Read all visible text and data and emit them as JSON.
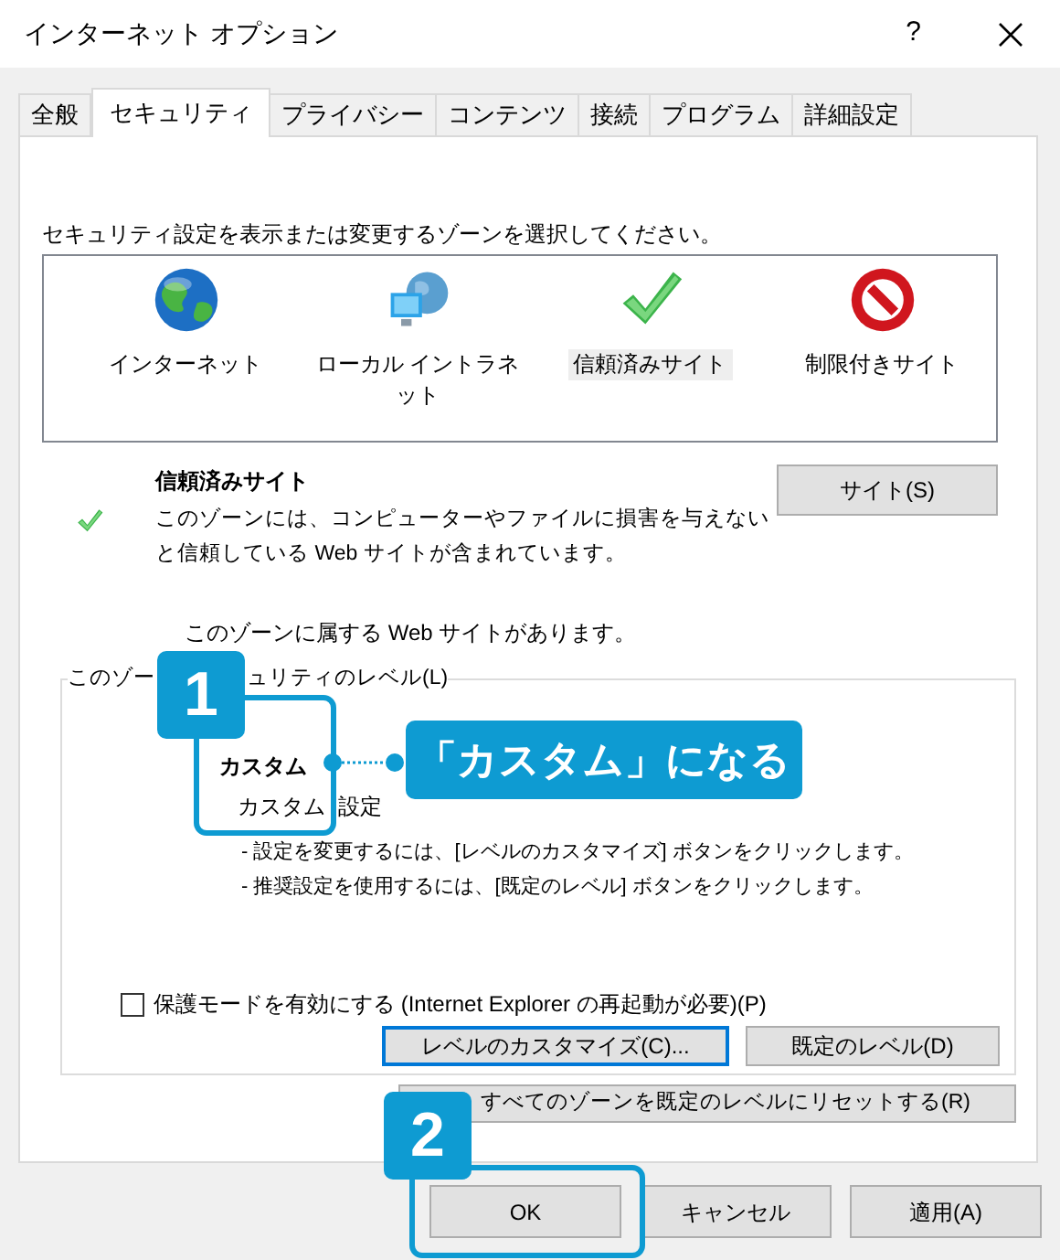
{
  "window": {
    "title": "インターネット オプション",
    "help": "?"
  },
  "tabs": [
    {
      "label": "全般",
      "selected": false
    },
    {
      "label": "セキュリティ",
      "selected": true
    },
    {
      "label": "プライバシー",
      "selected": false
    },
    {
      "label": "コンテンツ",
      "selected": false
    },
    {
      "label": "接続",
      "selected": false
    },
    {
      "label": "プログラム",
      "selected": false
    },
    {
      "label": "詳細設定",
      "selected": false
    }
  ],
  "instruction": "セキュリティ設定を表示または変更するゾーンを選択してください。",
  "zones": [
    {
      "label": "インターネット",
      "kind": "globe",
      "selected": false
    },
    {
      "label": "ローカル イントラネット",
      "kind": "network",
      "selected": false
    },
    {
      "label": "信頼済みサイト",
      "kind": "check",
      "selected": true
    },
    {
      "label": "制限付きサイト",
      "kind": "blocked",
      "selected": false
    }
  ],
  "zone_detail": {
    "title": "信頼済みサイト",
    "description": "このゾーンには、コンピューターやファイルに損害を与えないと信頼している Web サイトが含まれています。",
    "button": "サイト(S)",
    "note": "このゾーンに属する Web サイトがあります。"
  },
  "level_group": {
    "label_parts": [
      "このゾー",
      "ュリティのレベル(L)"
    ],
    "level_name": "カスタム",
    "level_desc": [
      "カスタム",
      "設定"
    ],
    "bullets": [
      "- 設定を変更するには、[レベルのカスタマイズ] ボタンをクリックします。",
      "- 推奨設定を使用するには、[既定のレベル] ボタンをクリックします。"
    ],
    "protected_mode": {
      "label": "保護モードを有効にする (Internet Explorer の再起動が必要)(P)",
      "checked": false
    },
    "buttons": [
      {
        "label": "レベルのカスタマイズ(C)...",
        "focused": true
      },
      {
        "label": "既定のレベル(D)",
        "focused": false
      }
    ]
  },
  "reset_button": "すべてのゾーンを既定のレベルにリセットする(R)",
  "dialog_buttons": [
    "OK",
    "キャンセル",
    "適用(A)"
  ],
  "annotations": [
    {
      "number": "1"
    },
    {
      "number": "2"
    }
  ],
  "callout": "「カスタム」になる"
}
